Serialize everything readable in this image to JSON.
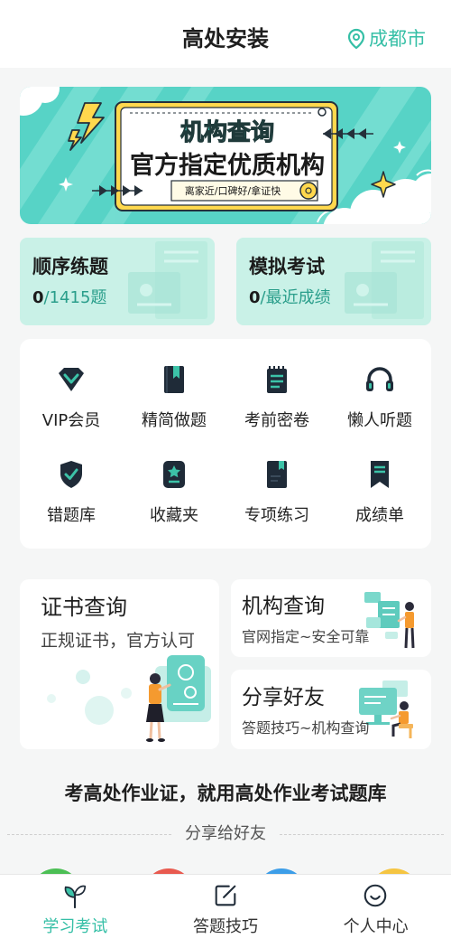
{
  "colors": {
    "accent": "#35bfa6",
    "accent_dark": "#2a9e8b",
    "card_mint": "#c9f1e7",
    "icon_dark": "#1f2b38",
    "page_bg": "#f5f6f6"
  },
  "header": {
    "title": "高处安装",
    "location": "成都市",
    "location_icon": "map-pin-icon"
  },
  "banner": {
    "ribbon": "机构查询",
    "headline": "官方指定优质机构",
    "tagline": "离家近/口碑好/拿证快"
  },
  "practice_cards": [
    {
      "title": "顺序练题",
      "count": "0",
      "suffix": "/1415题"
    },
    {
      "title": "模拟考试",
      "count": "0",
      "suffix": "/最近成绩"
    }
  ],
  "feature_grid": [
    {
      "label": "VIP会员",
      "icon": "vip-diamond-icon"
    },
    {
      "label": "精简做题",
      "icon": "book-icon"
    },
    {
      "label": "考前密卷",
      "icon": "exam-paper-icon"
    },
    {
      "label": "懒人听题",
      "icon": "headphones-icon"
    },
    {
      "label": "错题库",
      "icon": "shield-check-icon"
    },
    {
      "label": "收藏夹",
      "icon": "star-folder-icon"
    },
    {
      "label": "专项练习",
      "icon": "bookmarked-book-icon"
    },
    {
      "label": "成绩单",
      "icon": "ribbon-bookmark-icon"
    }
  ],
  "services": {
    "certificate": {
      "title": "证书查询",
      "subtitle": "正规证书，官方认可"
    },
    "institution": {
      "title": "机构查询",
      "subtitle": "官网指定~安全可靠"
    },
    "share": {
      "title": "分享好友",
      "subtitle": "答题技巧~机构查询"
    }
  },
  "slogan": "考高处作业证，就用高处作业考试题库",
  "share_section": {
    "divider_label": "分享给好友",
    "option_colors": [
      "#4cbf55",
      "#e85a4f",
      "#3d9ee8",
      "#f5c542"
    ]
  },
  "tabbar": [
    {
      "label": "学习考试",
      "icon": "sprout-icon",
      "active": true
    },
    {
      "label": "答题技巧",
      "icon": "edit-icon",
      "active": false
    },
    {
      "label": "个人中心",
      "icon": "smile-icon",
      "active": false
    }
  ]
}
